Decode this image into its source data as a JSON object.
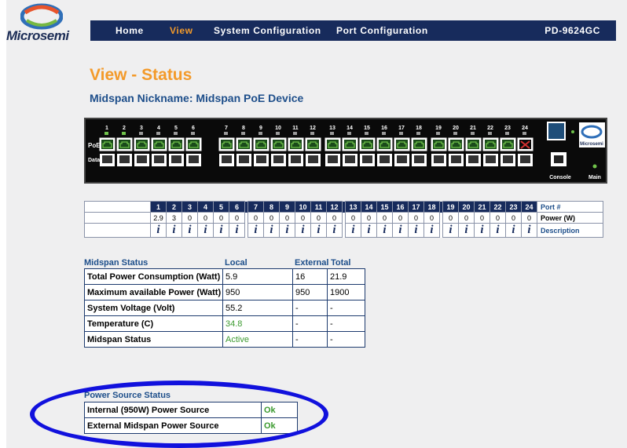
{
  "logo": {
    "text": "Microsemi"
  },
  "nav": {
    "items": [
      {
        "label": "Home",
        "active": false
      },
      {
        "label": "View",
        "active": true
      },
      {
        "label": "System Configuration",
        "active": false
      },
      {
        "label": "Port Configuration",
        "active": false
      }
    ],
    "model": "PD-9624GC"
  },
  "page": {
    "title": "View - Status",
    "nickname": "Midspan Nickname: Midspan PoE Device"
  },
  "device": {
    "port_numbers": [
      "1",
      "2",
      "3",
      "4",
      "5",
      "6",
      "7",
      "8",
      "9",
      "10",
      "11",
      "12",
      "13",
      "14",
      "15",
      "16",
      "17",
      "18",
      "19",
      "20",
      "21",
      "22",
      "23",
      "24"
    ],
    "row_labels": {
      "poe": "PoE",
      "data_in": "Data In"
    },
    "console_label": "Console",
    "main_label": "Main",
    "brand": "Microsemi",
    "colors": {
      "panel": "#0a0a0a",
      "port_active": "#6fc24a",
      "port_fault": "#d23030"
    }
  },
  "port_table": {
    "header_label": "Port #",
    "power_label": "Power (W)",
    "description_label": "Description",
    "ports": [
      "1",
      "2",
      "3",
      "4",
      "5",
      "6",
      "7",
      "8",
      "9",
      "10",
      "11",
      "12",
      "13",
      "14",
      "15",
      "16",
      "17",
      "18",
      "19",
      "20",
      "21",
      "22",
      "23",
      "24"
    ],
    "power": [
      "2.9",
      "3",
      "0",
      "0",
      "0",
      "0",
      "0",
      "0",
      "0",
      "0",
      "0",
      "0",
      "0",
      "0",
      "0",
      "0",
      "0",
      "0",
      "0",
      "0",
      "0",
      "0",
      "0",
      "0"
    ],
    "description_icon": "info-icon",
    "info_glyph": "i"
  },
  "midspan": {
    "headers": {
      "status": "Midspan Status",
      "local": "Local",
      "external": "External",
      "total": "Total"
    },
    "rows": [
      {
        "label": "Total Power Consumption (Watt)",
        "local": "5.9",
        "external": "16",
        "total": "21.9"
      },
      {
        "label": "Maximum available Power (Watt)",
        "local": "950",
        "external": "950",
        "total": "1900"
      },
      {
        "label": "System Voltage (Volt)",
        "local": "55.2",
        "external": "-",
        "total": "-"
      },
      {
        "label": "Temperature (C)",
        "local": "34.8",
        "external": "-",
        "total": "-"
      },
      {
        "label": "Midspan Status",
        "local": "Active",
        "external": "-",
        "total": "-"
      }
    ]
  },
  "power_source": {
    "title": "Power Source Status",
    "rows": [
      {
        "label": "Internal (950W) Power Source",
        "value": "Ok"
      },
      {
        "label": "External Midspan Power Source",
        "value": "Ok"
      }
    ]
  }
}
